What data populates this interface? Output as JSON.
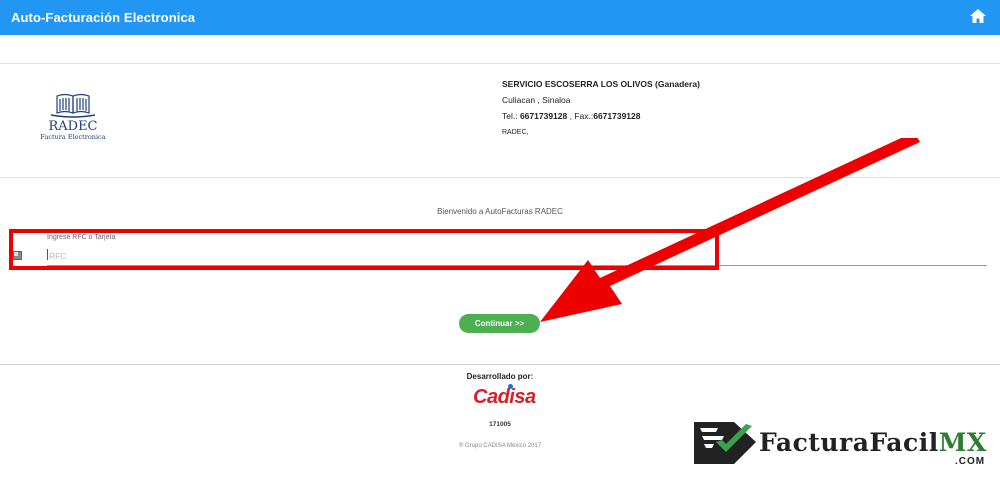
{
  "header": {
    "title": "Auto-Facturación Electronica",
    "home_icon": "home-icon",
    "bar_color": "#2196f3"
  },
  "logo": {
    "brand": "RADEC",
    "tagline": "Factura Electronica"
  },
  "company": {
    "name": "SERVICIO ESCOSERRA LOS OLIVOS (Ganadera)",
    "location": "Culiacan , Sinaloa",
    "tel_label": "Tel.: ",
    "tel": "6671739128",
    "fax_label": " , Fax.:",
    "fax": "6671739128",
    "extra": "RADEC,"
  },
  "form": {
    "welcome": "Bienvenido a AutoFacturas RADEC",
    "rfc_label": "Ingrese RFC o Tarjeta",
    "rfc_placeholder": "RFC",
    "rfc_value": "",
    "continue_label": "Continuar >>",
    "button_color": "#4caf50"
  },
  "annotation": {
    "highlight_color": "#ee0000"
  },
  "footer": {
    "developed_by": "Desarrollado por:",
    "developer_logo": "Cadisa",
    "build": "171005",
    "copyright": "® Grupo CADISA México 2017"
  },
  "watermark": {
    "brand_main": "FacturaFacil",
    "brand_accent": "MX",
    "brand_suffix": ".COM"
  }
}
